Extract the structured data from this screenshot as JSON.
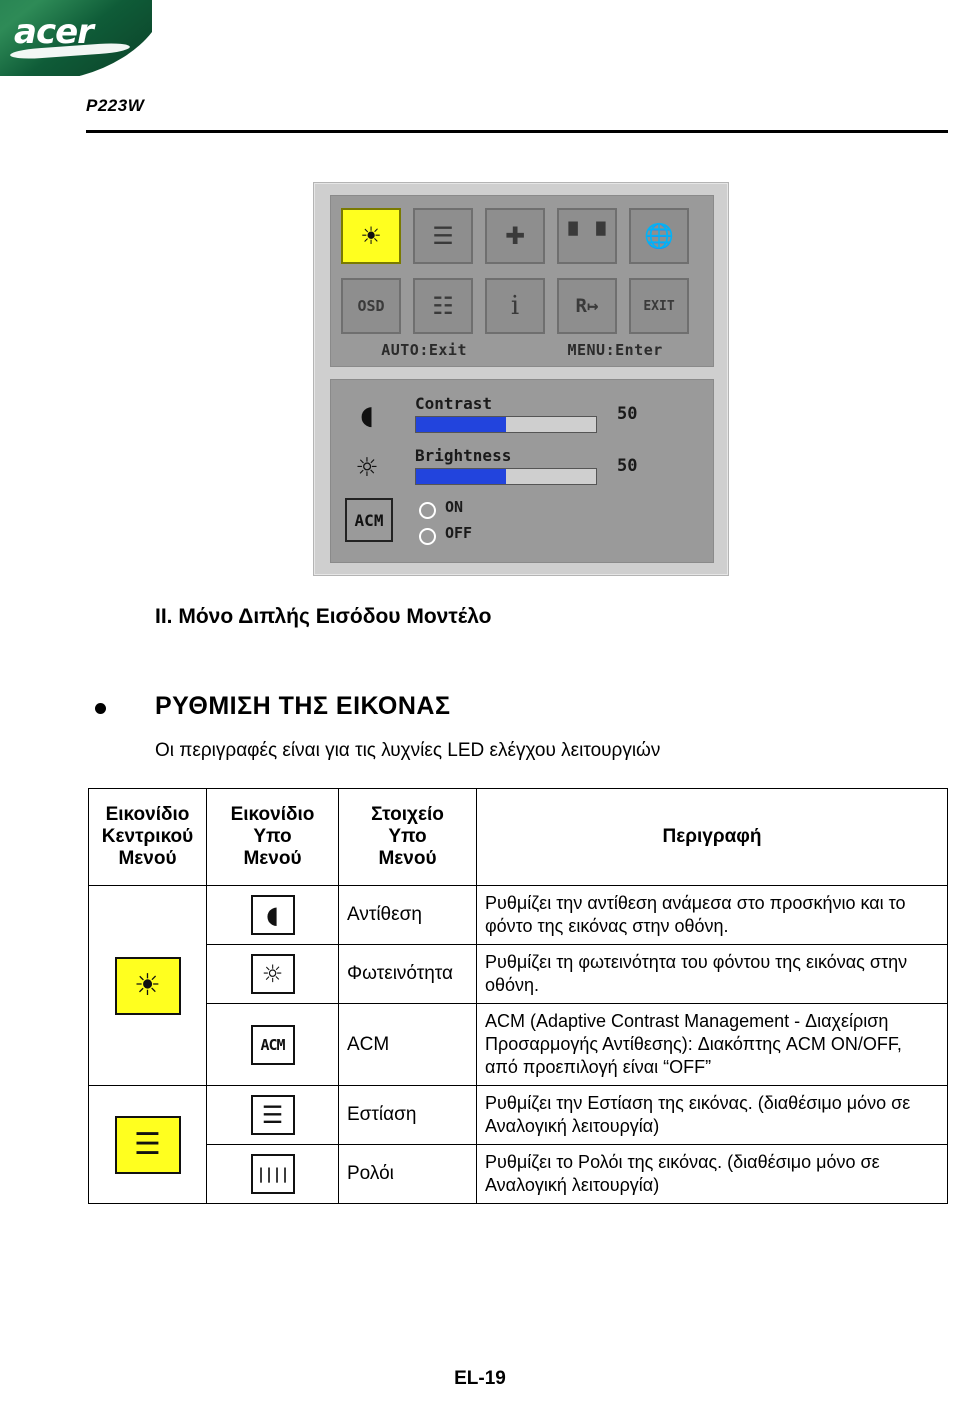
{
  "brand": {
    "logo_text": "acer"
  },
  "header": {
    "model": "P223W"
  },
  "osd": {
    "top_icons_row1": [
      "brightness-contrast",
      "image-setting",
      "position",
      "color",
      "language-globe"
    ],
    "top_icons_row2": [
      "OSD",
      "info-setting",
      "i",
      "R",
      "EXIT"
    ],
    "selected_icon_index": 0,
    "hints": {
      "left": "AUTO:Exit",
      "right": "MENU:Enter"
    },
    "contrast": {
      "label": "Contrast",
      "value": "50",
      "percent": 50
    },
    "brightness": {
      "label": "Brightness",
      "value": "50",
      "percent": 50
    },
    "acm": {
      "label": "ACM",
      "on": "ON",
      "off": "OFF"
    }
  },
  "section": {
    "title": "II. Μόνο Διπλής Εισόδου Μοντέλο",
    "heading": "ΡΥΘΜΙΣΗ ΤΗΣ ΕΙΚΟΝΑΣ",
    "subline": "Οι περιγραφές είναι για τις λυχνίες LED ελέγχου λειτουργιών"
  },
  "table": {
    "headers": {
      "main_menu": "Εικονίδιο\nΚεντρικού\nΜενού",
      "sub_menu": "Εικονίδιο\nΥπο\nΜενού",
      "sub_item": "Στοιχείο\nΥπο\nΜενού",
      "description": "Περιγραφή"
    },
    "headers_lines": {
      "main_menu": [
        "Εικονίδιο",
        "Κεντρικού",
        "Μενού"
      ],
      "sub_menu": [
        "Εικονίδιο",
        "Υπο",
        "Μενού"
      ],
      "sub_item": [
        "Στοιχείο",
        "Υπο",
        "Μενού"
      ],
      "description": [
        "Περιγραφή"
      ]
    },
    "rows": [
      {
        "main_icon": "brightness-contrast-icon",
        "sub_icon": "contrast-icon",
        "item": "Αντίθεση",
        "description": "Ρυθμίζει την αντίθεση ανάμεσα στο προσκήνιο και το φόντο της εικόνας στην οθόνη."
      },
      {
        "main_icon": "",
        "sub_icon": "brightness-icon",
        "item": "Φωτεινότητα",
        "description": "Ρυθμίζει τη φωτεινότητα του φόντου της εικόνας στην οθόνη."
      },
      {
        "main_icon": "",
        "sub_icon": "acm-icon",
        "item": "ACM",
        "description": "ACM (Adaptive Contrast Management - Διαχείριση Προσαρμογής Αντίθεσης): Διακόπτης ACM ON/OFF, από προεπιλογή είναι “OFF”"
      },
      {
        "main_icon": "image-setting-icon",
        "sub_icon": "focus-icon",
        "item": "Εστίαση",
        "description": "Ρυθμίζει την Εστίαση της εικόνας. (διαθέσιμο μόνο σε Αναλογική λειτουργία)"
      },
      {
        "main_icon": "",
        "sub_icon": "clock-icon",
        "item": "Ρολόι",
        "description": "Ρυθμίζει το Ρολόι της εικόνας. (διαθέσιμο μόνο σε Αναλογική λειτουργία)"
      }
    ]
  },
  "footer": {
    "page": "EL-19"
  }
}
